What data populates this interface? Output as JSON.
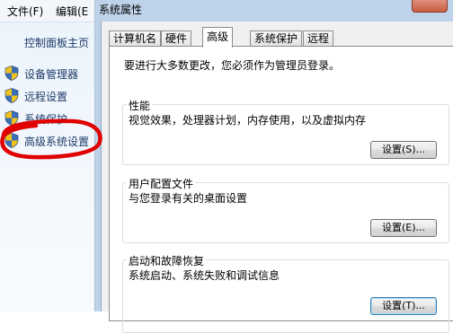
{
  "menubar": {
    "file": "文件(F)",
    "edit": "编辑(E"
  },
  "sidebar": {
    "home": "控制面板主页",
    "tasks": [
      {
        "label": "设备管理器",
        "icon": "uac-shield-icon"
      },
      {
        "label": "远程设置",
        "icon": "uac-shield-icon"
      },
      {
        "label": "系统保护",
        "icon": "uac-shield-icon"
      },
      {
        "label": "高级系统设置",
        "icon": "uac-shield-icon"
      }
    ]
  },
  "dialog": {
    "title": "系统属性",
    "tabs": [
      "计算机名",
      "硬件",
      "高级",
      "系统保护",
      "远程"
    ],
    "active_tab": "高级",
    "admin_notice": "要进行大多数更改，您必须作为管理员登录。",
    "groups": [
      {
        "title": "性能",
        "description": "视觉效果，处理器计划，内存使用，以及虚拟内存",
        "button": "设置(S)..."
      },
      {
        "title": "用户配置文件",
        "description": "与您登录有关的桌面设置",
        "button": "设置(E)..."
      },
      {
        "title": "启动和故障恢复",
        "description": "系统启动、系统失败和调试信息",
        "button": "设置(T)..."
      }
    ]
  },
  "colors": {
    "annotation_red": "#e00000",
    "link_text": "#1c3a66",
    "window_frame": "#bed3ea"
  }
}
